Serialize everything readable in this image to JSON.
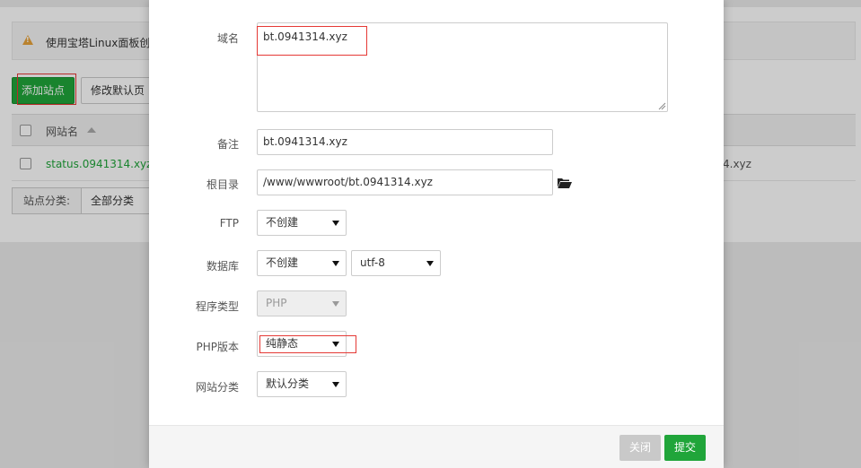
{
  "background": {
    "alert_text": "使用宝塔Linux面板创建",
    "add_site_button": "添加站点",
    "modify_default_page_button": "修改默认页",
    "table_header_site_name": "网站名",
    "row_site_name": "status.0941314.xyz",
    "row_right_text": "4.xyz",
    "site_category_label": "站点分类:",
    "site_category_value": "全部分类"
  },
  "form": {
    "domain_label": "域名",
    "domain_value": "bt.0941314.xyz",
    "remark_label": "备注",
    "remark_value": "bt.0941314.xyz",
    "root_dir_label": "根目录",
    "root_dir_value": "/www/wwwroot/bt.0941314.xyz",
    "ftp_label": "FTP",
    "ftp_value": "不创建",
    "database_label": "数据库",
    "database_value": "不创建",
    "charset_value": "utf-8",
    "program_type_label": "程序类型",
    "program_type_value": "PHP",
    "php_version_label": "PHP版本",
    "php_version_value": "纯静态",
    "site_category_label": "网站分类",
    "site_category_value": "默认分类"
  },
  "footer": {
    "close_button": "关闭",
    "submit_button": "提交"
  },
  "colors": {
    "accent_green": "#20a53a",
    "highlight_red": "#e53935",
    "warning_orange": "#e8a33a"
  }
}
